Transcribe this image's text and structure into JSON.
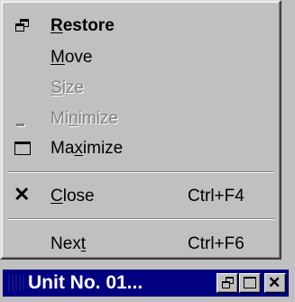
{
  "menu": {
    "items": [
      {
        "pre": "",
        "ul": "R",
        "post": "estore",
        "shortcut": "",
        "icon": "restore-icon",
        "state": "bold"
      },
      {
        "pre": "",
        "ul": "M",
        "post": "ove",
        "shortcut": "",
        "icon": "",
        "state": "normal"
      },
      {
        "pre": "",
        "ul": "S",
        "post": "ize",
        "shortcut": "",
        "icon": "",
        "state": "disabled"
      },
      {
        "pre": "Mi",
        "ul": "n",
        "post": "imize",
        "shortcut": "",
        "icon": "minimize-icon",
        "state": "disabled"
      },
      {
        "pre": "Ma",
        "ul": "x",
        "post": "imize",
        "shortcut": "",
        "icon": "maximize-icon",
        "state": "normal"
      },
      {
        "pre": "",
        "ul": "C",
        "post": "lose",
        "shortcut": "Ctrl+F4",
        "icon": "close-icon",
        "state": "normal"
      },
      {
        "pre": "Nex",
        "ul": "t",
        "post": "",
        "shortcut": "Ctrl+F6",
        "icon": "",
        "state": "normal"
      }
    ]
  },
  "window": {
    "title": "Unit No. 01...",
    "buttons": [
      "restore-icon",
      "maximize-icon",
      "close-icon"
    ]
  }
}
